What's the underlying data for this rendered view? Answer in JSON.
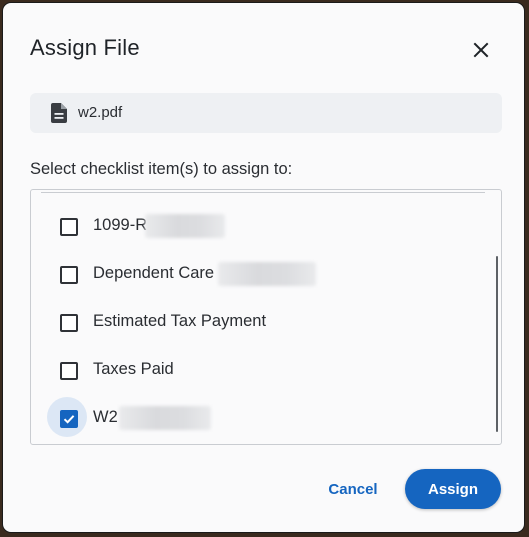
{
  "dialog": {
    "title": "Assign File",
    "close_icon": "close-icon",
    "file": {
      "icon": "document-icon",
      "name": "w2.pdf"
    },
    "prompt": "Select checklist item(s) to assign to:",
    "items": [
      {
        "label": "1099-R",
        "checked": false,
        "redacted": true
      },
      {
        "label": "Dependent Care",
        "checked": false,
        "redacted": true
      },
      {
        "label": "Estimated Tax Payment",
        "checked": false,
        "redacted": false
      },
      {
        "label": "Taxes Paid",
        "checked": false,
        "redacted": false
      },
      {
        "label": "W2",
        "checked": true,
        "redacted": true
      }
    ],
    "buttons": {
      "cancel": "Cancel",
      "assign": "Assign"
    }
  },
  "colors": {
    "accent": "#1565c0",
    "text": "#2a2d32",
    "chip_bg": "#eef0f3"
  }
}
